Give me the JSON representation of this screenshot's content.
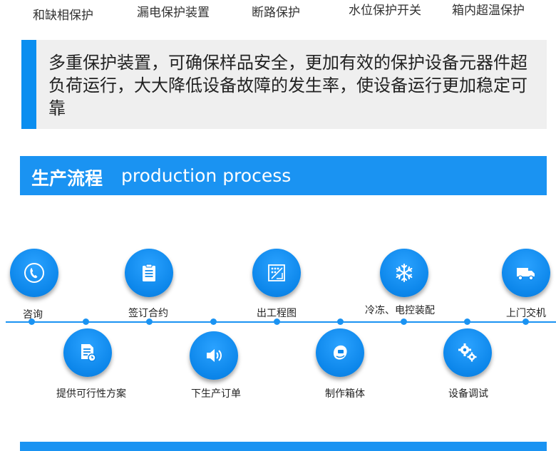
{
  "protections": [
    "和缺相保护",
    "漏电保护装置",
    "断路保护",
    "水位保护开关",
    "箱内超温保护"
  ],
  "notice": {
    "text": "多重保护装置，可确保样品安全，更加有效的保护设备元器件超负荷运行，大大降低设备故障的发生率，使设备运行更加稳定可靠"
  },
  "section": {
    "title_cn": "生产流程",
    "title_en": "production process"
  },
  "steps": [
    {
      "label": "咨询",
      "icon": "phone-icon"
    },
    {
      "label": "提供可行性方案",
      "icon": "document-icon"
    },
    {
      "label": "签订合约",
      "icon": "clipboard-icon"
    },
    {
      "label": "下生产订单",
      "icon": "speaker-icon"
    },
    {
      "label": "出工程图",
      "icon": "blueprint-icon"
    },
    {
      "label": "制作箱体",
      "icon": "welding-mask-icon"
    },
    {
      "label": "冷冻、电控装配",
      "icon": "snowflake-icon"
    },
    {
      "label": "设备调试",
      "icon": "gears-icon"
    },
    {
      "label": "上门交机",
      "icon": "truck-icon"
    }
  ],
  "colors": {
    "accent": "#1a93f2",
    "notice_bg": "#efefef"
  }
}
